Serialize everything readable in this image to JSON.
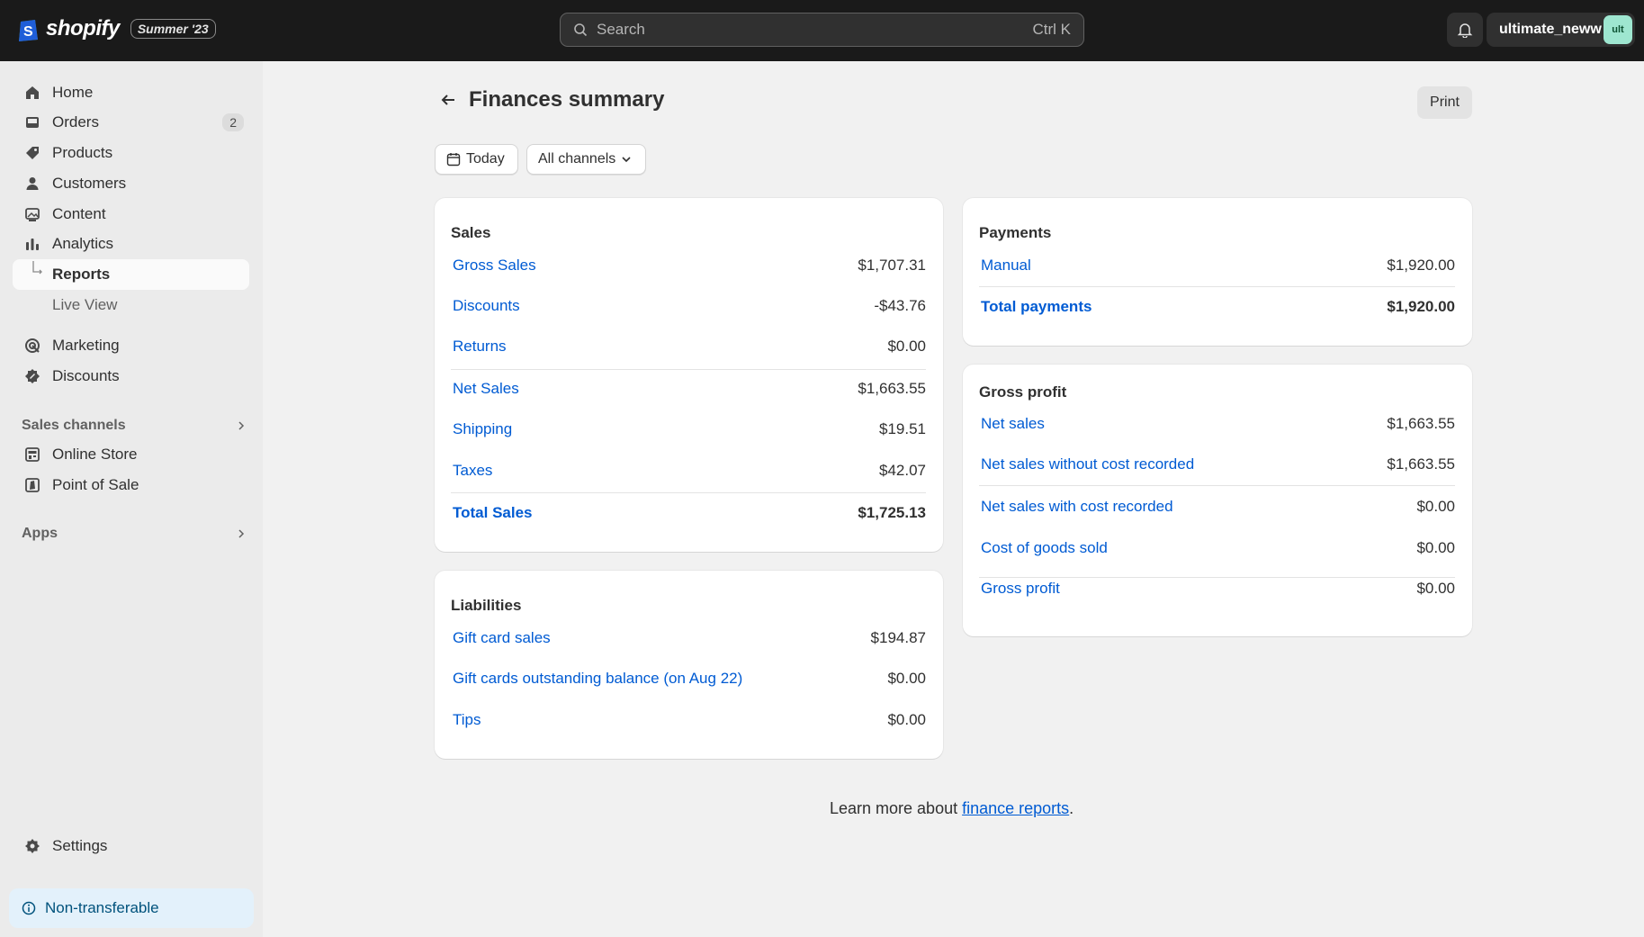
{
  "topbar": {
    "brand": "shopify",
    "edition": "Summer '23",
    "search_placeholder": "Search",
    "search_shortcut": "Ctrl K",
    "account_name": "ultimate_neww",
    "avatar_initials": "ult"
  },
  "sidebar": {
    "items": [
      {
        "label": "Home",
        "icon": "home-icon"
      },
      {
        "label": "Orders",
        "icon": "inbox-icon",
        "badge": "2"
      },
      {
        "label": "Products",
        "icon": "tag-icon"
      },
      {
        "label": "Customers",
        "icon": "person-icon"
      },
      {
        "label": "Content",
        "icon": "image-icon"
      },
      {
        "label": "Analytics",
        "icon": "bar-chart-icon"
      },
      {
        "label": "Reports",
        "icon": "subitem-arrow-icon"
      },
      {
        "label": "Live View"
      },
      {
        "label": "Marketing",
        "icon": "target-icon"
      },
      {
        "label": "Discounts",
        "icon": "discount-icon"
      }
    ],
    "sales_channels_title": "Sales channels",
    "channels": [
      {
        "label": "Online Store",
        "icon": "store-icon"
      },
      {
        "label": "Point of Sale",
        "icon": "pos-icon"
      }
    ],
    "apps_title": "Apps",
    "settings_label": "Settings",
    "notice": "Non-transferable"
  },
  "page": {
    "title": "Finances summary",
    "print_label": "Print",
    "date_filter": "Today",
    "channel_filter": "All channels"
  },
  "sales": {
    "title": "Sales",
    "rows": [
      {
        "label": "Gross Sales",
        "value": "$1,707.31"
      },
      {
        "label": "Discounts",
        "value": "-$43.76"
      },
      {
        "label": "Returns",
        "value": "$0.00"
      },
      {
        "label": "Net Sales",
        "value": "$1,663.55"
      },
      {
        "label": "Shipping",
        "value": "$19.51"
      },
      {
        "label": "Taxes",
        "value": "$42.07"
      },
      {
        "label": "Total Sales",
        "value": "$1,725.13"
      }
    ]
  },
  "liabilities": {
    "title": "Liabilities",
    "rows": [
      {
        "label": "Gift card sales",
        "value": "$194.87"
      },
      {
        "label": "Gift cards outstanding balance (on Aug 22)",
        "value": "$0.00"
      },
      {
        "label": "Tips",
        "value": "$0.00"
      }
    ]
  },
  "payments": {
    "title": "Payments",
    "rows": [
      {
        "label": "Manual",
        "value": "$1,920.00"
      },
      {
        "label": "Total payments",
        "value": "$1,920.00"
      }
    ]
  },
  "gross_profit": {
    "title": "Gross profit",
    "rows": [
      {
        "label": "Net sales",
        "value": "$1,663.55"
      },
      {
        "label": "Net sales without cost recorded",
        "value": "$1,663.55"
      },
      {
        "label": "Net sales with cost recorded",
        "value": "$0.00"
      },
      {
        "label": "Cost of goods sold",
        "value": "$0.00"
      },
      {
        "label": "Gross profit",
        "value": "$0.00"
      }
    ]
  },
  "footer": {
    "learn_prefix": "Learn more about ",
    "learn_link": "finance reports",
    "learn_suffix": "."
  },
  "colors": {
    "topbar": "#1a1a1a",
    "link": "#005bd3",
    "sidebar": "#ebebeb",
    "canvas": "#f1f1f1"
  }
}
